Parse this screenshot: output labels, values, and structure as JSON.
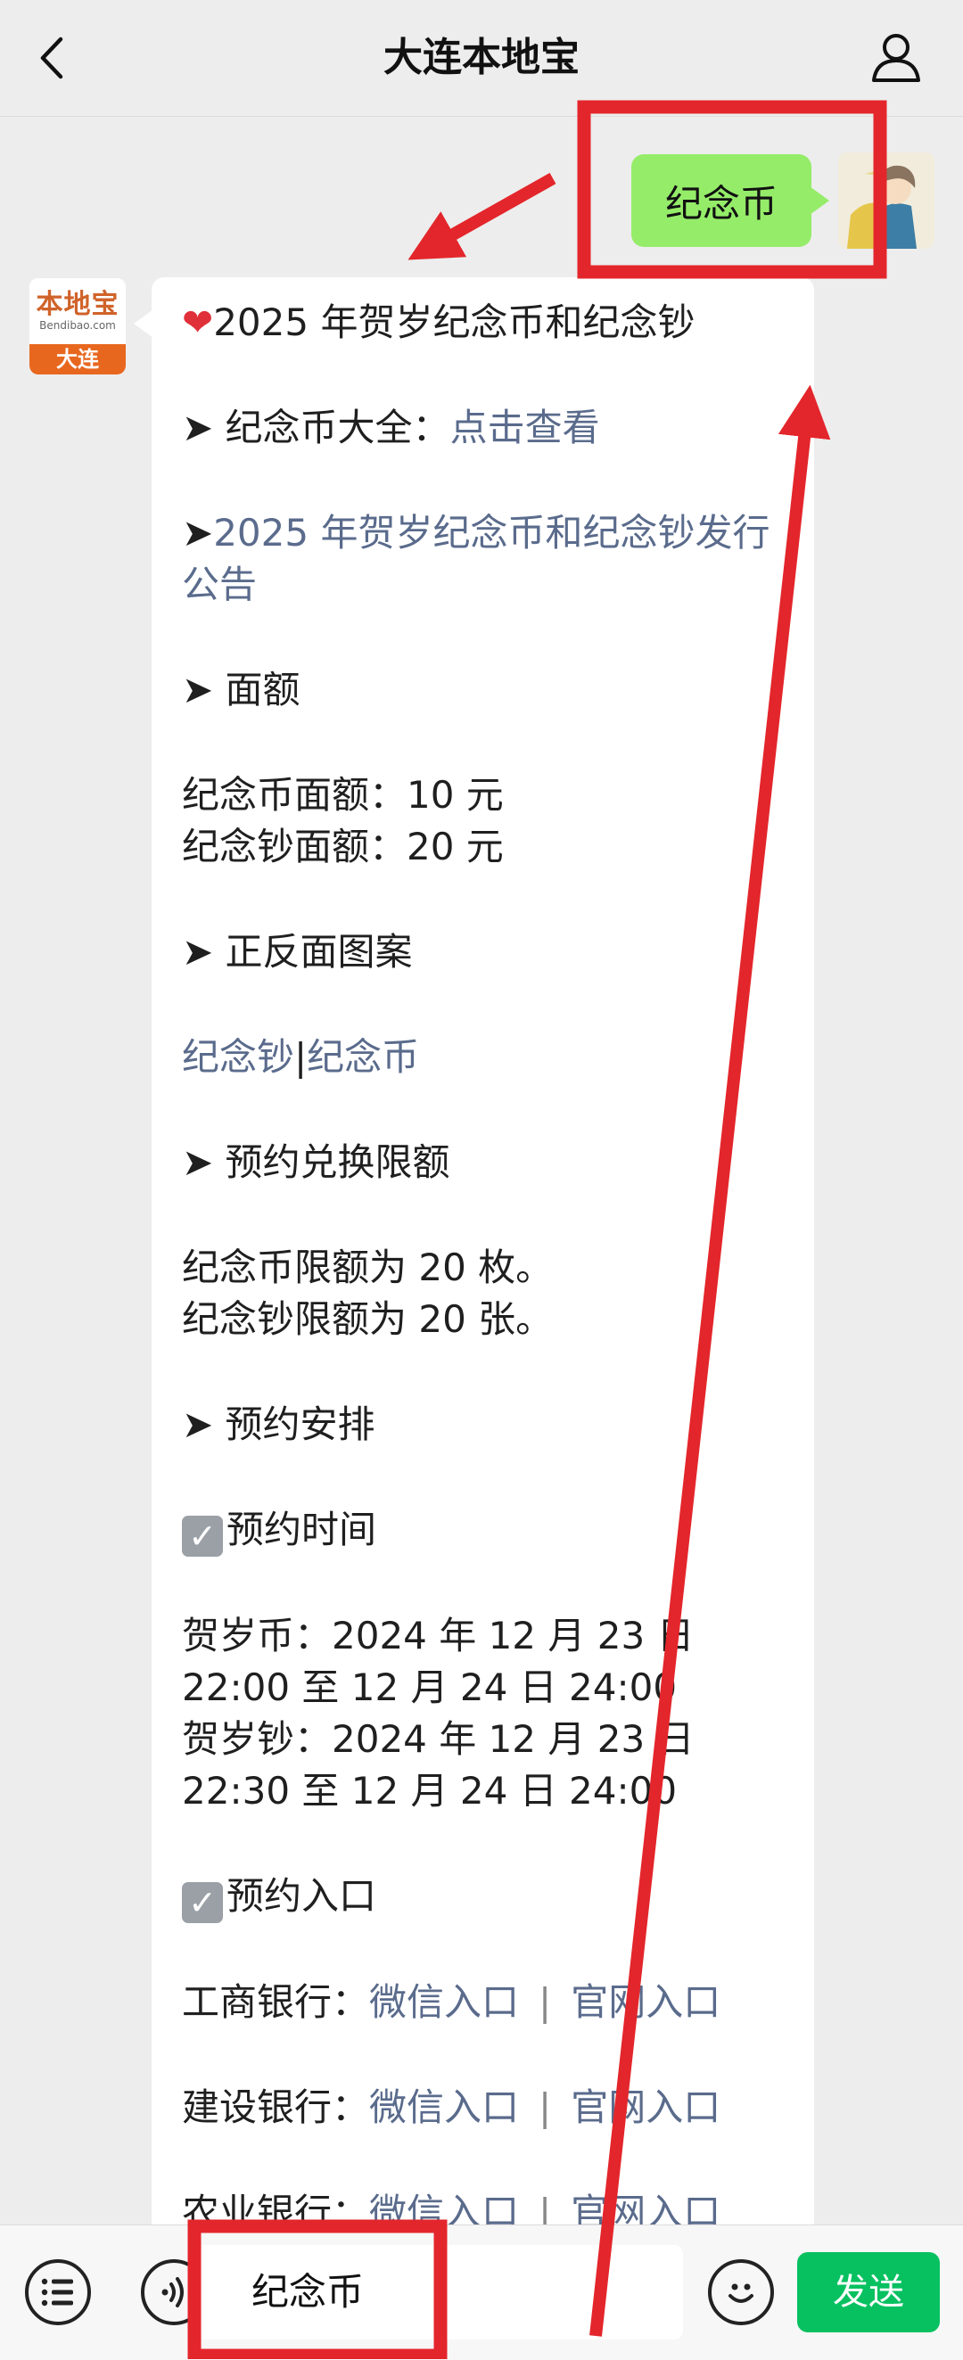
{
  "header": {
    "title": "大连本地宝"
  },
  "chat": {
    "user_message": "纪念币",
    "bot_avatar": {
      "logo_text": "本地宝",
      "logo_sub": "Bendibao.com",
      "city": "大连"
    },
    "bot_message": {
      "headline": "2025 年贺岁纪念币和纪念钞",
      "catalog_label": "纪念币大全：",
      "catalog_link": "点击查看",
      "announcement_link": "2025 年贺岁纪念币和纪念钞发行公告",
      "face_value_title": "面额",
      "coin_face_value": "纪念币面额：10 元",
      "note_face_value": "纪念钞面额：20 元",
      "pattern_title": "正反面图案",
      "pattern_note_link": "纪念钞",
      "pattern_sep": "|",
      "pattern_coin_link": "纪念币",
      "limit_title": "预约兑换限额",
      "coin_limit": "纪念币限额为 20 枚。",
      "note_limit": "纪念钞限额为 20 张。",
      "schedule_title": "预约安排",
      "time_title": "预约时间",
      "coin_time": "贺岁币：2024 年 12 月 23 日 22:00 至 12 月 24 日 24:00",
      "note_time": "贺岁钞：2024 年 12 月 23 日 22:30 至 12 月 24 日 24:00",
      "entry_title": "预约入口",
      "banks": [
        {
          "name": "工商银行：",
          "wechat": "微信入口",
          "sep": "|",
          "site": "官网入口"
        },
        {
          "name": "建设银行：",
          "wechat": "微信入口",
          "sep": "|",
          "site": "官网入口"
        },
        {
          "name": "农业银行：",
          "wechat": "微信入口",
          "sep": "|",
          "site": "官网入口"
        }
      ]
    }
  },
  "input_bar": {
    "input_value": "纪念币",
    "send_label": "发送"
  },
  "colors": {
    "background": "#ededed",
    "user_bubble": "#95ec69",
    "send_button": "#07c160",
    "link": "#5a6b8c",
    "annotation_red": "#e3262b"
  },
  "icons": [
    "back-arrow-icon",
    "profile-icon",
    "menu-list-icon",
    "voice-icon",
    "emoji-icon",
    "heart-icon",
    "arrow-bullet-icon",
    "checkbox-icon"
  ]
}
